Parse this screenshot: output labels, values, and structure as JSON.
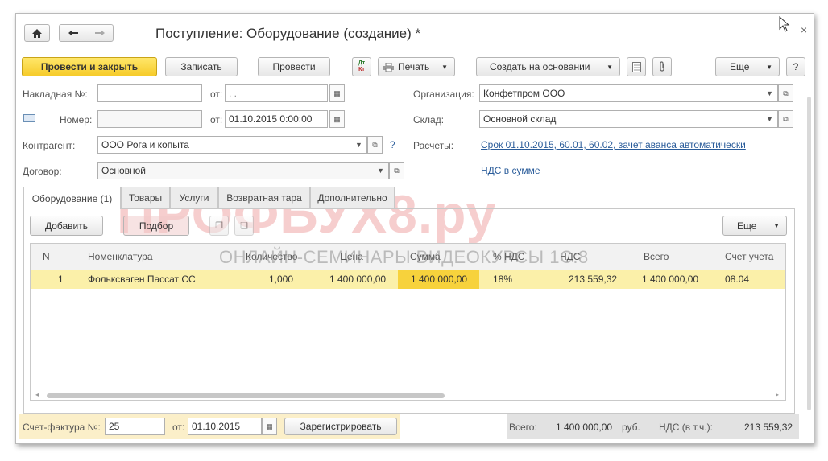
{
  "window": {
    "title": "Поступление: Оборудование (создание) *",
    "close": "×"
  },
  "toolbar": {
    "post_close": "Провести и закрыть",
    "save": "Записать",
    "post": "Провести",
    "dtkt_top": "Дт",
    "dtkt_bottom": "Кт",
    "print": "Печать",
    "create_based": "Создать на основании",
    "more": "Еще",
    "help": "?"
  },
  "form": {
    "invoice_label": "Накладная  №:",
    "invoice_value": "",
    "from_label": "от:",
    "invoice_date": " .  .",
    "number_label": "Номер:",
    "number_value": "",
    "number_date": "01.10.2015  0:00:00",
    "counterparty_label": "Контрагент:",
    "counterparty_value": "ООО Рога и копыта",
    "counterparty_help": "?",
    "contract_label": "Договор:",
    "contract_value": "Основной",
    "org_label": "Организация:",
    "org_value": "Конфетпром ООО",
    "warehouse_label": "Склад:",
    "warehouse_value": "Основной склад",
    "settlements_label": "Расчеты:",
    "settlements_link": "Срок 01.10.2015, 60.01, 60.02, зачет аванса автоматически",
    "vat_link": "НДС в сумме"
  },
  "tabs": [
    "Оборудование (1)",
    "Товары",
    "Услуги",
    "Возвратная тара",
    "Дополнительно"
  ],
  "table_toolbar": {
    "add": "Добавить",
    "select": "Подбор",
    "more": "Еще"
  },
  "table": {
    "headers": [
      "N",
      "Номенклатура",
      "Количество",
      "Цена",
      "Сумма",
      "% НДС",
      "НДС",
      "Всего",
      "Счет учета"
    ],
    "rows": [
      [
        "1",
        "Фольксваген Пассат СС",
        "1,000",
        "1 400 000,00",
        "1 400 000,00",
        "18%",
        "213 559,32",
        "1 400 000,00",
        "08.04"
      ]
    ]
  },
  "footer": {
    "sf_label": "Счет-фактура №:",
    "sf_number": "25",
    "sf_from": "от:",
    "sf_date": "01.10.2015",
    "register": "Зарегистрировать",
    "total_label": "Всего:",
    "total_value": "1 400 000,00",
    "currency": "руб.",
    "vat_label": "НДС (в т.ч.):",
    "vat_value": "213 559,32"
  },
  "watermark": {
    "brand": "ПРОФБУХ8.ру",
    "tagline": "ОНЛАЙН-СЕМИНАРЫ ВИДЕОКУРСЫ 1С:8"
  },
  "colors": {
    "primary_button": "#f6cb2a",
    "selected_row": "#fbf0a9",
    "selected_cell": "#f7d23c",
    "link": "#2a5c9a",
    "footer_highlight": "#fbefc9"
  }
}
